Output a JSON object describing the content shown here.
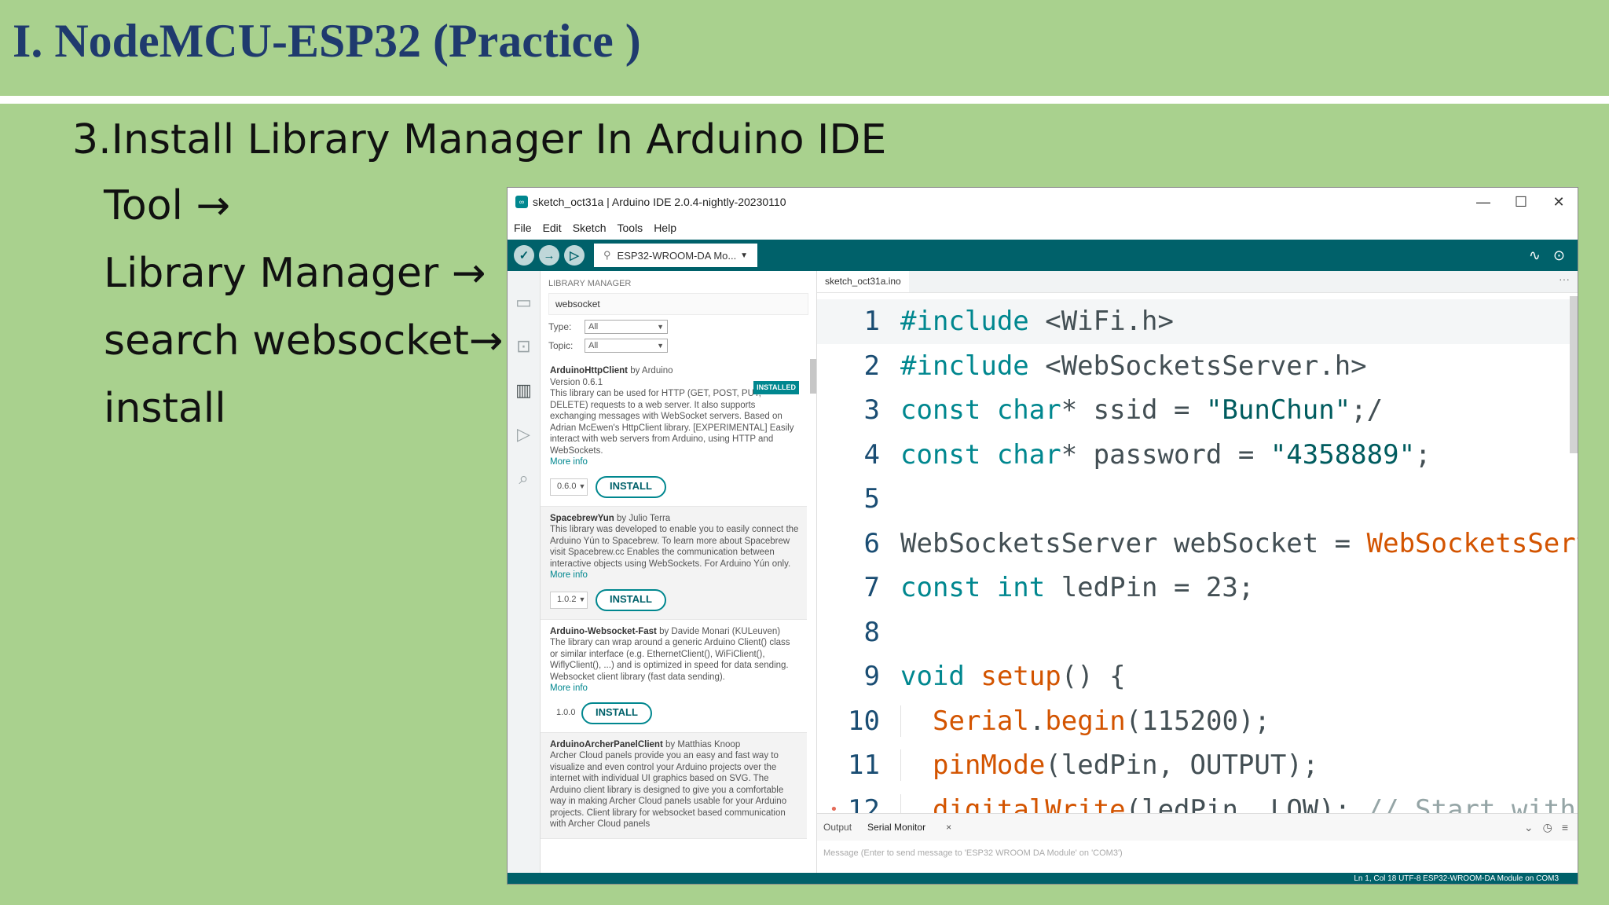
{
  "slide": {
    "title": "I. NodeMCU-ESP32 (Practice  )",
    "subtitle": "3.Install Library Manager In Arduino IDE",
    "steps": [
      "Tool →",
      "Library Manager →",
      "search websocket→",
      "install"
    ]
  },
  "window": {
    "title": "sketch_oct31a | Arduino IDE 2.0.4-nightly-20230110",
    "controls": [
      "—",
      "☐",
      "✕"
    ]
  },
  "menu": [
    "File",
    "Edit",
    "Sketch",
    "Tools",
    "Help"
  ],
  "toolbar": {
    "board": "ESP32-WROOM-DA Mo...",
    "icons": [
      "verify-icon",
      "upload-icon",
      "debug-icon",
      "serial-plotter-icon",
      "serial-monitor-icon"
    ]
  },
  "library_manager": {
    "header": "LIBRARY MANAGER",
    "search_value": "websocket",
    "type_label": "Type:",
    "type_value": "All",
    "topic_label": "Topic:",
    "topic_value": "All",
    "items": [
      {
        "name": "ArduinoHttpClient",
        "author": " by Arduino",
        "version_line": "Version 0.6.1",
        "badge": "INSTALLED",
        "desc": "This library can be used for HTTP (GET, POST, PUT, DELETE) requests to a web server. It also supports exchanging messages with WebSocket servers. Based on Adrian McEwen's HttpClient library. [EXPERIMENTAL] Easily interact with web servers from Arduino, using HTTP and WebSockets.",
        "more": "More info",
        "version": "0.6.0",
        "install": "INSTALL"
      },
      {
        "name": "SpacebrewYun",
        "author": " by Julio Terra",
        "desc": "This library was developed to enable you to easily connect the Arduino Yún to Spacebrew. To learn more about Spacebrew visit Spacebrew.cc Enables the communication between interactive objects using WebSockets. For Arduino Yún only.",
        "more": "More info",
        "version": "1.0.2",
        "install": "INSTALL"
      },
      {
        "name": "Arduino-Websocket-Fast",
        "author": " by Davide Monari (KULeuven)",
        "desc": "The library can wrap around a generic Arduino Client() class or similar interface (e.g. EthernetClient(), WiFiClient(), WiflyClient(), ...) and is optimized in speed for data sending. Websocket client library (fast data sending).",
        "more": "More info",
        "version": "1.0.0",
        "install": "INSTALL"
      },
      {
        "name": "ArduinoArcherPanelClient",
        "author": " by Matthias Knoop",
        "desc": "Archer Cloud panels provide you an easy and fast way to visualize and even control your Arduino projects over the internet with individual UI graphics based on SVG. The Arduino client library is designed to give you a comfortable way in making Archer Cloud panels usable for your Arduino projects. Client library for websocket based communication with Archer Cloud panels"
      }
    ]
  },
  "editor": {
    "tab": "sketch_oct31a.ino",
    "lines": [
      {
        "n": "1",
        "tokens": [
          {
            "c": "t-kw",
            "t": "#include"
          },
          {
            "c": "",
            "t": " <WiFi.h>"
          }
        ]
      },
      {
        "n": "2",
        "tokens": [
          {
            "c": "t-kw",
            "t": "#include"
          },
          {
            "c": "",
            "t": " <WebSocketsServer.h>"
          }
        ]
      },
      {
        "n": "3",
        "tokens": [
          {
            "c": "t-kw",
            "t": "const char"
          },
          {
            "c": "",
            "t": "* ssid = "
          },
          {
            "c": "t-str",
            "t": "\"BunChun\""
          },
          {
            "c": "",
            "t": ";/"
          }
        ]
      },
      {
        "n": "4",
        "tokens": [
          {
            "c": "t-kw",
            "t": "const char"
          },
          {
            "c": "",
            "t": "* password = "
          },
          {
            "c": "t-str",
            "t": "\"4358889\""
          },
          {
            "c": "",
            "t": ";"
          }
        ]
      },
      {
        "n": "5",
        "tokens": []
      },
      {
        "n": "6",
        "tokens": [
          {
            "c": "",
            "t": "WebSocketsServer webSocket = "
          },
          {
            "c": "t-fn",
            "t": "WebSocketsServ"
          }
        ]
      },
      {
        "n": "7",
        "tokens": [
          {
            "c": "t-kw",
            "t": "const int"
          },
          {
            "c": "",
            "t": " ledPin = 23;"
          }
        ]
      },
      {
        "n": "8",
        "tokens": []
      },
      {
        "n": "9",
        "tokens": [
          {
            "c": "t-kw",
            "t": "void"
          },
          {
            "c": "",
            "t": " "
          },
          {
            "c": "t-fn",
            "t": "setup"
          },
          {
            "c": "",
            "t": "() {"
          }
        ]
      },
      {
        "n": "10",
        "indent": true,
        "tokens": [
          {
            "c": "t-fn",
            "t": "Serial"
          },
          {
            "c": "",
            "t": "."
          },
          {
            "c": "t-fn",
            "t": "begin"
          },
          {
            "c": "",
            "t": "(115200);"
          }
        ]
      },
      {
        "n": "11",
        "indent": true,
        "tokens": [
          {
            "c": "t-fn",
            "t": "pinMode"
          },
          {
            "c": "",
            "t": "(ledPin, OUTPUT);"
          }
        ]
      },
      {
        "n": "12",
        "indent": true,
        "dot": "•",
        "tokens": [
          {
            "c": "t-fn",
            "t": "digitalWrite"
          },
          {
            "c": "",
            "t": "(ledPin, LOW); "
          },
          {
            "c": "t-cm",
            "t": "// Start with"
          }
        ]
      }
    ]
  },
  "bottom_panel": {
    "tab_output": "Output",
    "tab_serial": "Serial Monitor",
    "close": "×",
    "message": "Message (Enter to send message to 'ESP32 WROOM DA Module' on 'COM3')"
  },
  "status_bar": "Ln 1, Col 18   UTF-8   ESP32-WROOM-DA Module on COM3"
}
